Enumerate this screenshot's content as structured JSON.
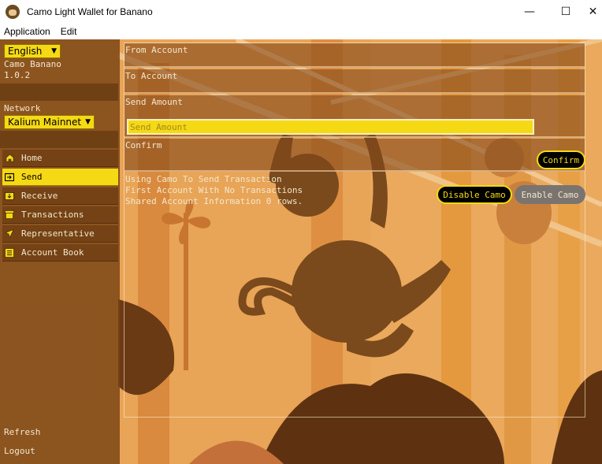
{
  "window": {
    "title": "Camo Light Wallet for Banano",
    "minimize_glyph": "—",
    "maximize_glyph": "☐",
    "close_glyph": "✕"
  },
  "menu": {
    "application": "Application",
    "edit": "Edit"
  },
  "sidebar": {
    "language": "English",
    "app_name": "Camo Banano",
    "version": "1.0.2",
    "network_label": "Network",
    "network": "Kalium Mainnet",
    "nav": [
      {
        "label": "Home",
        "icon": "home-icon"
      },
      {
        "label": "Send",
        "icon": "send-icon",
        "active": true
      },
      {
        "label": "Receive",
        "icon": "receive-icon"
      },
      {
        "label": "Transactions",
        "icon": "transactions-icon"
      },
      {
        "label": "Representative",
        "icon": "representative-icon"
      },
      {
        "label": "Account Book",
        "icon": "account-book-icon"
      }
    ],
    "refresh": "Refresh",
    "logout": "Logout"
  },
  "send": {
    "from_label": "From Account",
    "to_label": "To Account",
    "amount_label": "Send Amount",
    "amount_placeholder": "Send Amount",
    "confirm_label": "Confirm",
    "confirm_button": "Confirm"
  },
  "camo": {
    "status_lines": [
      "Using Camo To Send Transaction",
      "First Account With No Transactions",
      "Shared Account Information 0 rows."
    ],
    "disable_button": "Disable Camo",
    "enable_button": "Enable Camo"
  },
  "colors": {
    "accent": "#f5d915",
    "sidebar": "#7a4214",
    "background": "#e6a052",
    "text_light": "#f3e7cc"
  }
}
